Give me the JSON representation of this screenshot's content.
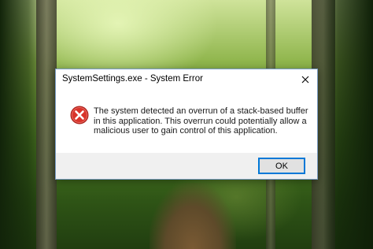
{
  "dialog": {
    "title": "SystemSettings.exe - System Error",
    "message": "The system detected an overrun of a stack-based buffer in this application. This overrun could potentially allow a malicious user to gain control of this application.",
    "icon": "error-icon",
    "close_icon": "close-icon",
    "ok_label": "OK"
  },
  "colors": {
    "error_red": "#d9342b",
    "button_focus_border": "#0078d7",
    "footer_bg": "#f0f0f0"
  }
}
